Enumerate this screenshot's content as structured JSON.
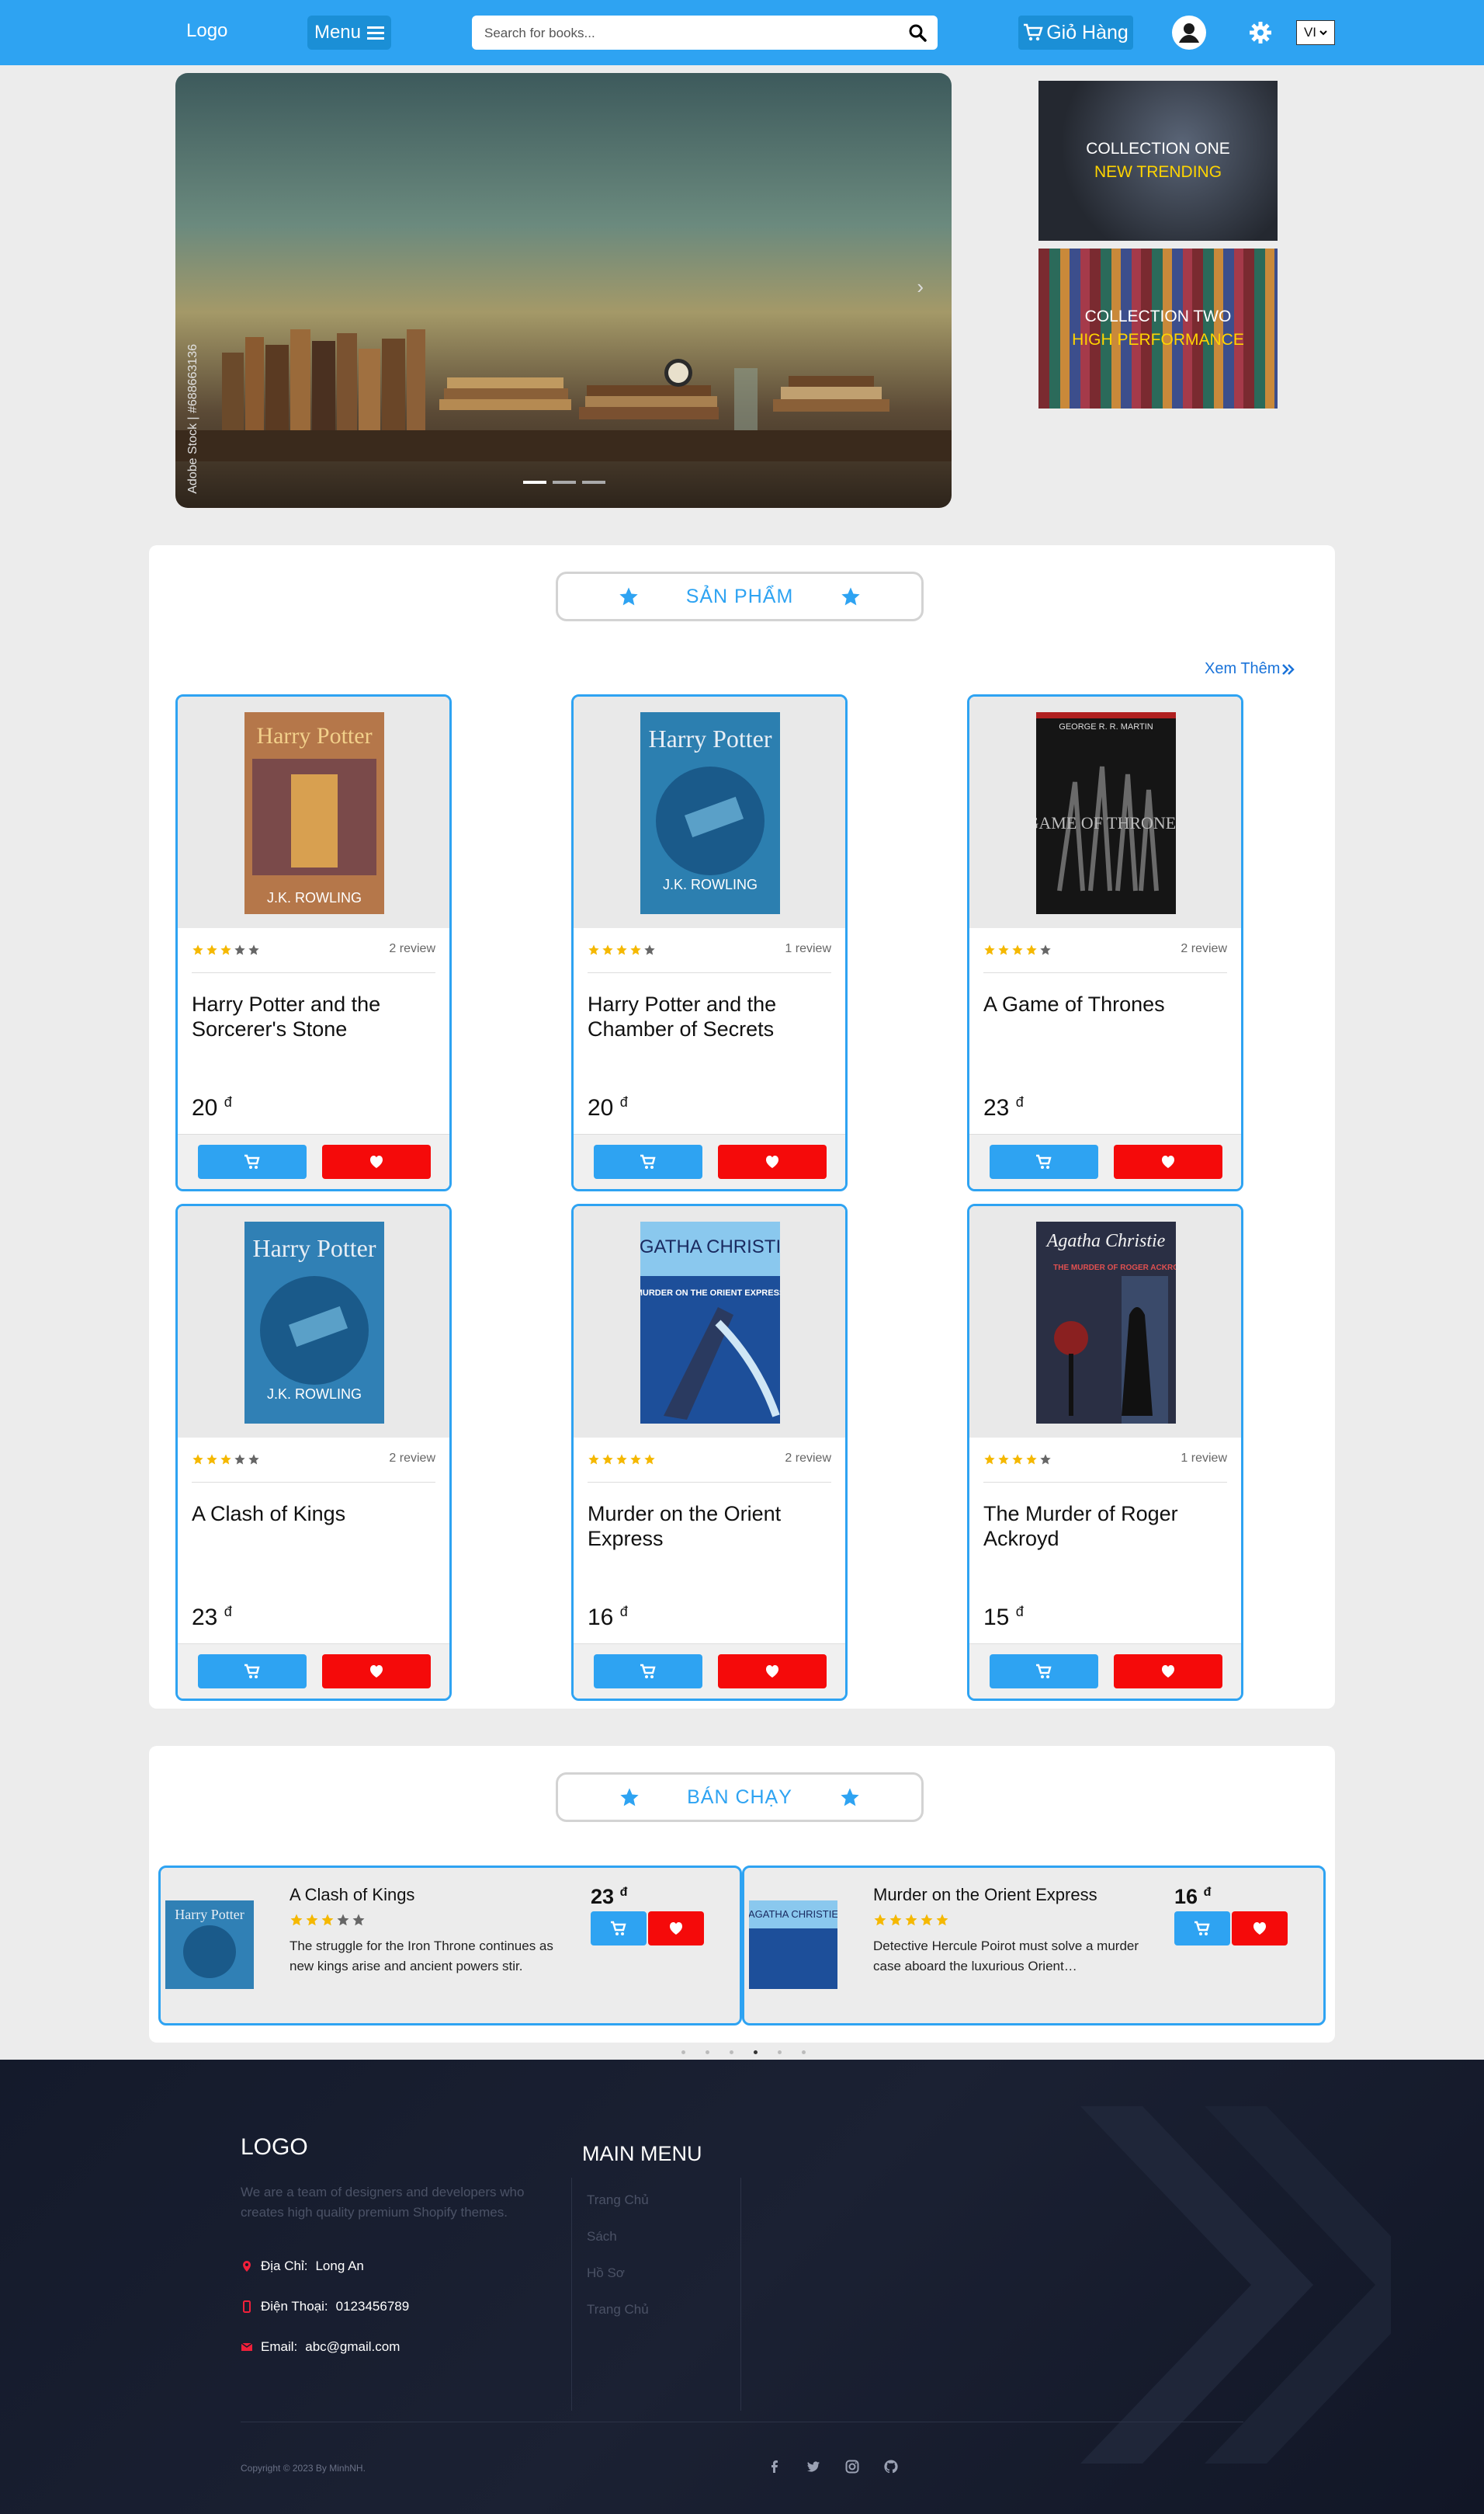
{
  "navbar": {
    "logo": "Logo",
    "menu_label": "Menu",
    "search_placeholder": "Search for books...",
    "cart_label": "Giỏ Hàng",
    "language": "VI"
  },
  "hero": {
    "watermark": "Adobe Stock | #688663136",
    "collections": [
      {
        "line1": "COLLECTION ONE",
        "line2": "NEW TRENDING"
      },
      {
        "line1": "COLLECTION TWO",
        "line2": "HIGH PERFORMANCE"
      }
    ]
  },
  "products_section": {
    "title": "SẢN PHẨM",
    "see_more": "Xem Thêm",
    "products": [
      {
        "name": "Harry Potter and the Sorcerer's Stone",
        "rating": 3,
        "reviews": "2 review",
        "price": "20",
        "currency": "đ"
      },
      {
        "name": "Harry Potter and the Chamber of Secrets",
        "rating": 4,
        "reviews": "1 review",
        "price": "20",
        "currency": "đ"
      },
      {
        "name": "A Game of Thrones",
        "rating": 4,
        "reviews": "2 review",
        "price": "23",
        "currency": "đ"
      },
      {
        "name": "A Clash of Kings",
        "rating": 3,
        "reviews": "2 review",
        "price": "23",
        "currency": "đ"
      },
      {
        "name": "Murder on the Orient Express",
        "rating": 5,
        "reviews": "2 review",
        "price": "16",
        "currency": "đ"
      },
      {
        "name": "The Murder of Roger Ackroyd",
        "rating": 4,
        "reviews": "1 review",
        "price": "15",
        "currency": "đ"
      }
    ],
    "cover_text": {
      "hp1_title": "Harry Potter",
      "hp1_author": "J.K. ROWLING",
      "hp2_title": "Harry Potter",
      "hp2_author": "J.K. ROWLING",
      "got_author": "GEORGE R. R. MARTIN",
      "got_title": "GAME OF THRONES",
      "ck_title": "Harry Potter",
      "ck_author": "J.K. ROWLING",
      "orient_author": "AGATHA CHRISTIE",
      "orient_title": "MURDER ON THE ORIENT EXPRESS",
      "roger_author": "Agatha Christie",
      "roger_title": "THE MURDER OF ROGER ACKROYD"
    }
  },
  "bestseller_section": {
    "title": "BÁN CHẠY",
    "items": [
      {
        "name": "A Clash of Kings",
        "rating": 3,
        "description": "The struggle for the Iron Throne continues as new kings arise and ancient powers stir.",
        "price": "23",
        "currency": "đ"
      },
      {
        "name": "Murder on the Orient Express",
        "rating": 5,
        "description": "Detective Hercule Poirot must solve a murder case aboard the luxurious Orient…",
        "price": "16",
        "currency": "đ"
      }
    ],
    "active_dot": 3
  },
  "footer": {
    "logo": "LOGO",
    "about": "We are a team of designers and developers who creates high quality premium Shopify themes.",
    "address_label": "Địa Chỉ:",
    "address": "Long An",
    "phone_label": "Điện Thoại:",
    "phone": "0123456789",
    "email_label": "Email:",
    "email": "abc@gmail.com",
    "menu_title": "MAIN MENU",
    "menu_items": [
      "Trang Chủ",
      "Sách",
      "Hồ Sơ",
      "Trang Chủ"
    ],
    "copyright": "Copyright © 2023 By MinhNH.",
    "social": [
      "facebook-icon",
      "twitter-icon",
      "instagram-icon",
      "github-icon"
    ]
  },
  "colors": {
    "primary": "#2ea3f2",
    "danger": "#f50a0a",
    "star": "#f5b800",
    "footer_bg": "#141a2b"
  }
}
